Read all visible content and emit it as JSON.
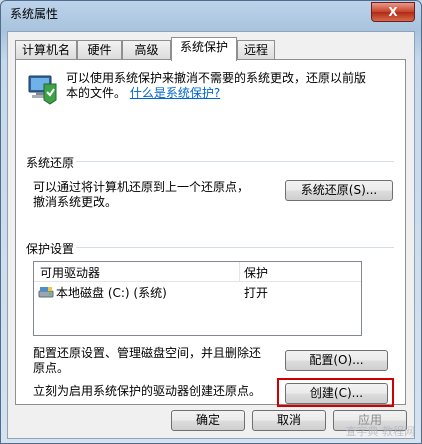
{
  "window": {
    "title": "系统属性",
    "close_label": "X"
  },
  "tabs": [
    {
      "label": "计算机名"
    },
    {
      "label": "硬件"
    },
    {
      "label": "高级"
    },
    {
      "label": "系统保护",
      "active": true
    },
    {
      "label": "远程"
    }
  ],
  "intro": {
    "text_line1": "可以使用系统保护来撤消不需要的系统更改，还原以前版",
    "text_line2": "本的文件。",
    "link": "什么是系统保护?"
  },
  "restore": {
    "section_label": "系统还原",
    "description_line1": "可以通过将计算机还原到上一个还原点，",
    "description_line2": "撤消系统更改。",
    "button_label": "系统还原(S)..."
  },
  "protection": {
    "section_label": "保护设置",
    "columns": [
      "可用驱动器",
      "保护"
    ],
    "rows": [
      {
        "drive": "本地磁盘 (C:) (系统)",
        "status": "打开"
      }
    ],
    "configure_text_line1": "配置还原设置、管理磁盘空间，并且删除还",
    "configure_text_line2": "原点。",
    "configure_button": "配置(O)...",
    "create_text": "立刻为启用系统保护的驱动器创建还原点。",
    "create_button": "创建(C)..."
  },
  "footer": {
    "ok": "确定",
    "cancel": "取消",
    "apply": "应用"
  },
  "watermark": "查字典 教程网",
  "colors": {
    "highlight": "#d00000",
    "link": "#0066cc"
  }
}
